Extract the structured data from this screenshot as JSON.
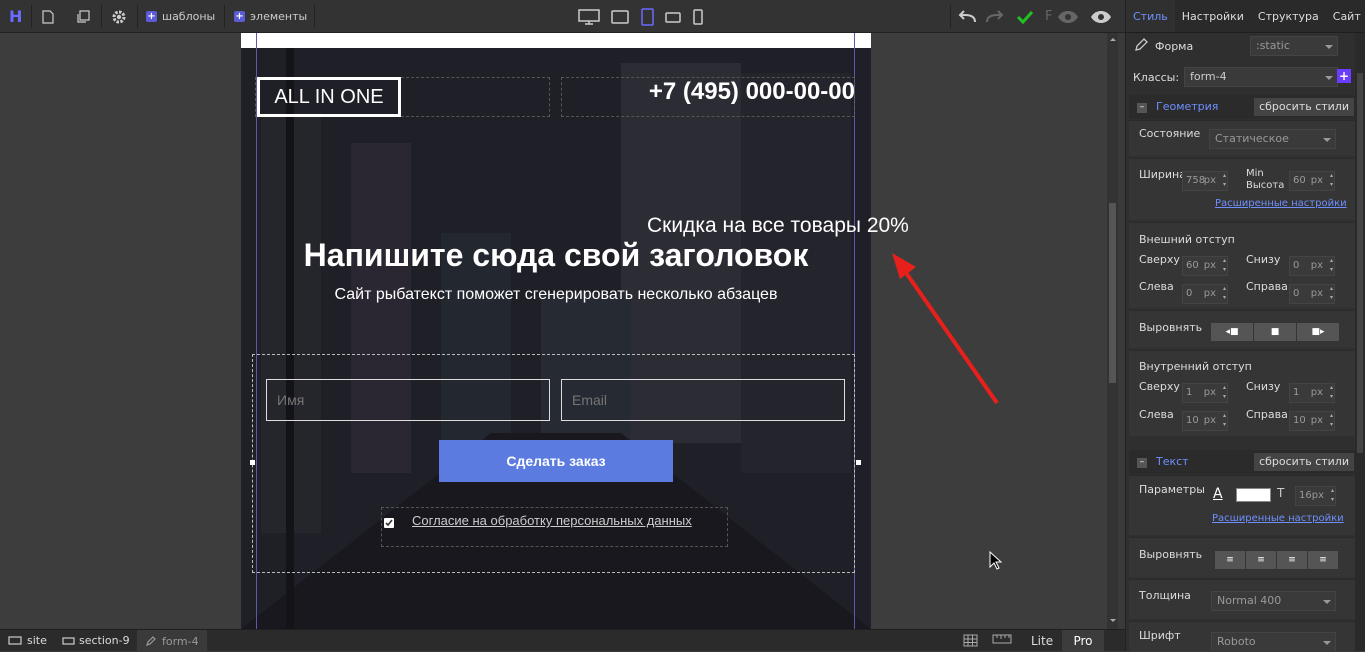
{
  "toolbar": {
    "logo": "H",
    "templates_label": "шаблоны",
    "elements_label": "элементы",
    "f_label": "F"
  },
  "page": {
    "logo": "ALL IN ONE",
    "phone": "+7 (495) 000-00-00",
    "heading": "Напишите сюда свой заголовок",
    "subheading": "Сайт рыбатекст поможет сгенерировать несколько абзацев",
    "name_placeholder": "Имя",
    "email_placeholder": "Email",
    "submit_label": "Сделать заказ",
    "consent_label": "Согласие на обработку персональных данных",
    "consent_checked": true
  },
  "annotation": {
    "text": "Скидка на все товары 20%",
    "arrow_color": "#e8201c"
  },
  "panel": {
    "tabs": [
      "Стиль",
      "Настройки",
      "Структура",
      "Сайт"
    ],
    "active_tab": "Стиль",
    "element_label": "Форма",
    "state_value": ":static",
    "classes_label": "Классы:",
    "classes_value": "form-4",
    "geometry": {
      "title": "Геометрия",
      "reset_label": "сбросить стили",
      "state_label": "Состояние",
      "state_value": "Статическое",
      "width_label": "Ширина",
      "width_value": "758",
      "width_unit": "px",
      "minheight_label": "Min Высота",
      "minheight_value": "60",
      "minheight_unit": "px",
      "advanced_link": "Расширенные настройки",
      "margin_label": "Внешний отступ",
      "top_label": "Сверху",
      "bottom_label": "Снизу",
      "left_label": "Слева",
      "right_label": "Справа",
      "margin_top": "60",
      "margin_bottom": "0",
      "margin_left": "0",
      "margin_right": "0",
      "align_label": "Выровнять",
      "padding_label": "Внутренний отступ",
      "padding_top": "1",
      "padding_bottom": "1",
      "padding_left": "10",
      "padding_right": "10",
      "unit": "px"
    },
    "text": {
      "title": "Текст",
      "reset_label": "сбросить стили",
      "params_label": "Параметры",
      "font_size": "16",
      "font_unit": "px",
      "advanced_link": "Расширенные настройки",
      "align_label": "Выровнять",
      "weight_label": "Толщина",
      "weight_value": "Normal 400",
      "font_label": "Шрифт",
      "font_value": "Roboto"
    }
  },
  "breadcrumbs": [
    "site",
    "section-9",
    "form-4"
  ],
  "modes": {
    "lite": "Lite",
    "pro": "Pro",
    "active": "Pro"
  }
}
